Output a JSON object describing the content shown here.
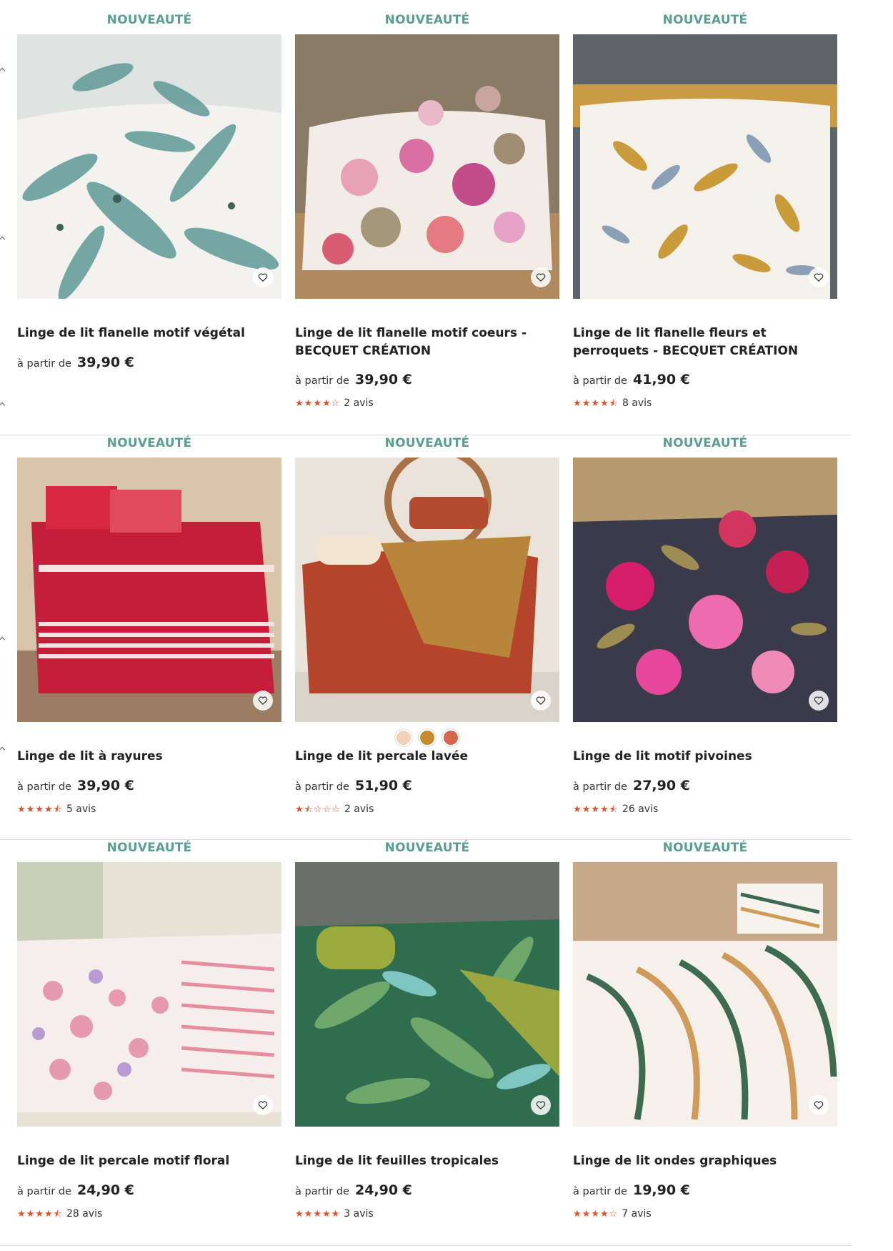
{
  "badge_label": "NOUVEAUTÉ",
  "from_label": "à partir de",
  "products": [
    {
      "title": "Linge de lit flanelle motif végétal",
      "price": "39,90 €",
      "rating": null,
      "reviews": null,
      "image": "leaf-bedding-image"
    },
    {
      "title": "Linge de lit flanelle motif coeurs - BECQUET CRÉATION",
      "price": "39,90 €",
      "rating": 4,
      "reviews": "2 avis",
      "image": "hearts-bedding-image"
    },
    {
      "title": "Linge de lit flanelle fleurs et perroquets - BECQUET CRÉATION",
      "price": "41,90 €",
      "rating": 4.5,
      "reviews": "8 avis",
      "image": "parrots-bedding-image"
    },
    {
      "title": "Linge de lit à rayures",
      "price": "39,90 €",
      "rating": 4.5,
      "reviews": "5 avis",
      "image": "stripes-bedding-image"
    },
    {
      "title": "Linge de lit percale lavée",
      "price": "51,90 €",
      "rating": 1.5,
      "reviews": "2 avis",
      "image": "washed-percale-bedding-image",
      "swatches": [
        "#f2d3b9",
        "#c98a2b",
        "#d9654a"
      ]
    },
    {
      "title": "Linge de lit motif pivoines",
      "price": "27,90 €",
      "rating": 4.5,
      "reviews": "26 avis",
      "image": "peonies-bedding-image"
    },
    {
      "title": "Linge de lit percale motif floral",
      "price": "24,90 €",
      "rating": 4.5,
      "reviews": "28 avis",
      "image": "floral-bedding-image"
    },
    {
      "title": "Linge de lit feuilles tropicales",
      "price": "24,90 €",
      "rating": 5,
      "reviews": "3 avis",
      "image": "tropical-bedding-image"
    },
    {
      "title": "Linge de lit ondes graphiques",
      "price": "19,90 €",
      "rating": 4,
      "reviews": "7 avis",
      "image": "waves-bedding-image"
    }
  ],
  "colors": {
    "badge": "#5a9e94",
    "star": "#d9532c"
  }
}
